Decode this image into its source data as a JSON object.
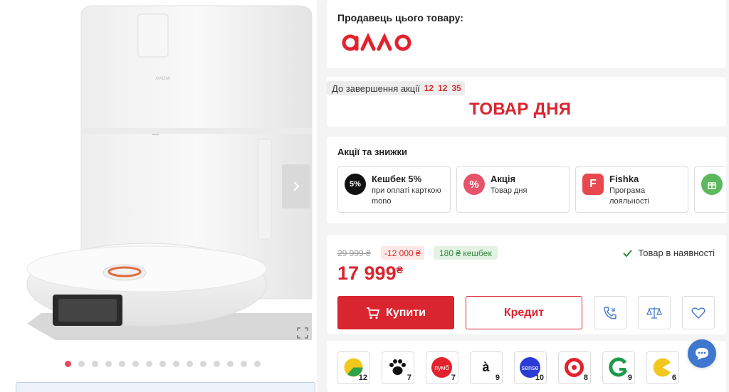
{
  "gallery": {
    "brand_text": "XIAOMI",
    "slides": 15,
    "active_slide": 0
  },
  "seller": {
    "title": "Продавець цього товару:",
    "logo_text": "алло",
    "logo_color": "#e2222c"
  },
  "promo": {
    "timer_label": "До завершення акції",
    "timer_hours": "12",
    "timer_minutes": "12",
    "timer_seconds": "35",
    "banner": "ТОВАР ДНЯ"
  },
  "deals": {
    "title": "Акції та знижки",
    "items": [
      {
        "icon": "mono-5-icon",
        "icon_text": "5%",
        "title": "Кешбек 5%",
        "subtitle": "при оплаті карткою mono",
        "color": "#111111"
      },
      {
        "icon": "percent-icon",
        "icon_text": "%",
        "title": "Акція",
        "subtitle": "Товар дня",
        "color": "#e5556a"
      },
      {
        "icon": "fishka-icon",
        "icon_text": "F",
        "title": "Fishka",
        "subtitle": "Програма лояльності",
        "color": "#e8484d"
      }
    ]
  },
  "price": {
    "old_price": "29 999 ₴",
    "discount": "-12 000 ₴",
    "cashback": "180 ₴ кешбек",
    "availability": "Товар в наявності",
    "current": "17 999",
    "currency": "₴",
    "buy_label": "Купити",
    "credit_label": "Кредит",
    "accent": "#d9252f"
  },
  "partners": [
    {
      "name": "partner-pie-icon",
      "count": "12",
      "color": "#f2c81c",
      "text": ""
    },
    {
      "name": "partner-paw-icon",
      "count": "7",
      "color": "#111111",
      "text": ""
    },
    {
      "name": "partner-pumb-icon",
      "count": "7",
      "color": "#e2222c",
      "text": "пумб"
    },
    {
      "name": "partner-a-icon",
      "count": "9",
      "color": "#22b14c",
      "text": "à"
    },
    {
      "name": "partner-sense-icon",
      "count": "10",
      "color": "#2a3bd6",
      "text": "sense"
    },
    {
      "name": "partner-ring-icon",
      "count": "8",
      "color": "#e2222c",
      "text": ""
    },
    {
      "name": "partner-g-icon",
      "count": "9",
      "color": "#1e9a4a",
      "text": ""
    },
    {
      "name": "partner-pac-icon",
      "count": "6",
      "color": "#f2c81c",
      "text": ""
    }
  ]
}
